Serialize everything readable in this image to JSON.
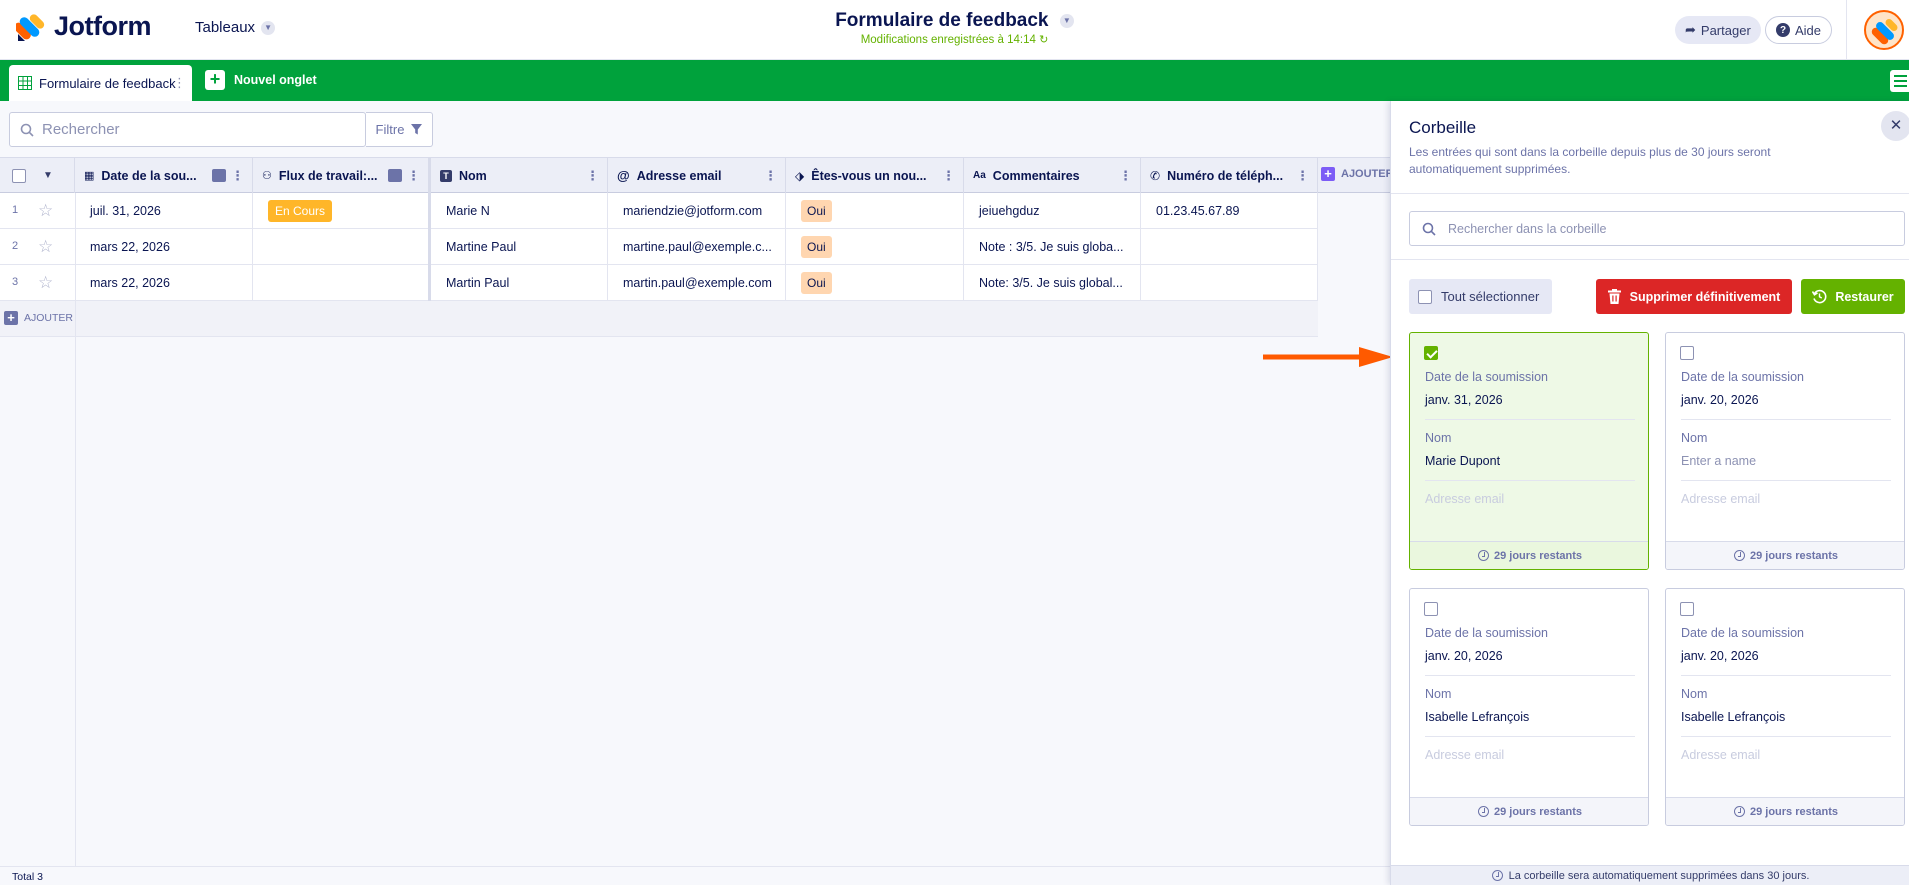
{
  "header": {
    "brand": "Jotform",
    "tables_menu": "Tableaux",
    "form_title": "Formulaire de feedback",
    "saved_status": "Modifications enregistrées à 14:14",
    "share_label": "Partager",
    "help_label": "Aide"
  },
  "tabs": {
    "active_tab": "Formulaire de feedback",
    "new_tab_label": "Nouvel onglet"
  },
  "toolbar": {
    "search_placeholder": "Rechercher",
    "filter_label": "Filtre"
  },
  "table": {
    "columns": [
      "Date de la sou...",
      "Flux de travail:...",
      "Nom",
      "Adresse email",
      "Êtes-vous un nou...",
      "Commentaires",
      "Numéro de téléph..."
    ],
    "add_column_label": "AJOUTER",
    "rows": [
      {
        "num": "1",
        "date": "juil. 31, 2026",
        "workflow": "En Cours",
        "name": "Marie N",
        "email": "mariendzie@jotform.com",
        "new_client": "Oui",
        "comments": "jeiuehgduz",
        "phone": "01.23.45.67.89"
      },
      {
        "num": "2",
        "date": "mars 22, 2026",
        "workflow": "",
        "name": "Martine Paul",
        "email": "martine.paul@exemple.c...",
        "new_client": "Oui",
        "comments": "Note : 3/5. Je suis globa...",
        "phone": ""
      },
      {
        "num": "3",
        "date": "mars 22, 2026",
        "workflow": "",
        "name": "Martin Paul",
        "email": "martin.paul@exemple.com",
        "new_client": "Oui",
        "comments": "Note: 3/5. Je suis global...",
        "phone": ""
      }
    ],
    "add_row_label": "AJOUTER",
    "total_label": "Total 3"
  },
  "trash": {
    "title": "Corbeille",
    "description": "Les entrées qui sont dans la corbeille depuis plus de 30 jours seront automatiquement supprimées.",
    "search_placeholder": "Rechercher dans la corbeille",
    "select_all_label": "Tout sélectionner",
    "delete_label": "Supprimer définitivement",
    "restore_label": "Restaurer",
    "field_date_label": "Date de la soumission",
    "field_name_label": "Nom",
    "field_email_label": "Adresse email",
    "name_placeholder": "Enter a name",
    "cards": [
      {
        "date": "janv. 31, 2026",
        "name": "Marie Dupont",
        "remaining": "29 jours restants",
        "selected": true
      },
      {
        "date": "janv. 20, 2026",
        "name": "",
        "remaining": "29 jours restants",
        "selected": false
      },
      {
        "date": "janv. 20, 2026",
        "name": "Isabelle Lefrançois",
        "remaining": "29 jours restants",
        "selected": false
      },
      {
        "date": "janv. 20, 2026",
        "name": "Isabelle Lefrançois",
        "remaining": "29 jours restants",
        "selected": false
      }
    ],
    "footer_note": "La corbeille sera automatiquement supprimées dans 30 jours."
  },
  "colors": {
    "brand_green": "#00a23c",
    "accent_green": "#64b200",
    "danger_red": "#dc2626",
    "arrow_orange": "#ff5a00",
    "navy": "#0a1551"
  }
}
